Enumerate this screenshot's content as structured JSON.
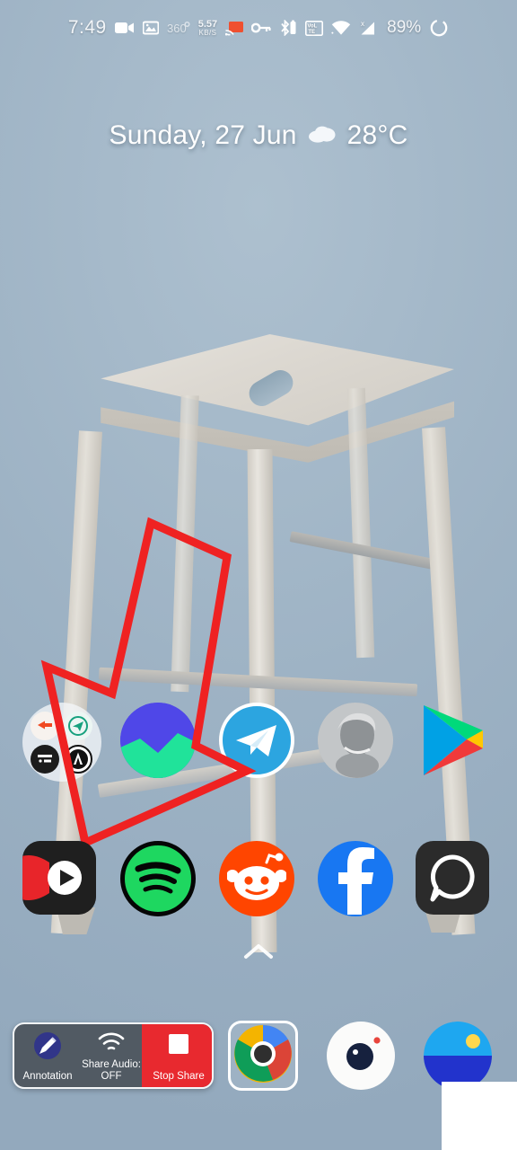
{
  "status_bar": {
    "clock": "7:49",
    "network_speed_value": "5.57",
    "network_speed_unit": "KB/S",
    "battery_percent": "89%",
    "icons": [
      {
        "name": "video-recording-icon",
        "glyph": "▭"
      },
      {
        "name": "screenshot-image-icon",
        "glyph": "▣"
      },
      {
        "name": "360-degree-icon",
        "glyph": "360"
      },
      {
        "name": "cast-icon",
        "glyph": "cast"
      },
      {
        "name": "vpn-key-icon",
        "glyph": "key"
      },
      {
        "name": "bluetooth-icon",
        "glyph": "bt"
      },
      {
        "name": "volte-icon",
        "glyph": "VoLTE"
      },
      {
        "name": "wifi-icon",
        "glyph": "wifi"
      },
      {
        "name": "mobile-signal-icon",
        "glyph": "signal"
      },
      {
        "name": "battery-charging-icon",
        "glyph": "circle"
      }
    ]
  },
  "date_widget": {
    "date_text": "Sunday, 27 Jun",
    "weather_icon": "cloud-icon",
    "temperature": "28°C"
  },
  "home": {
    "page_indicator_glyph": "⌃",
    "row1": [
      {
        "name": "app-folder",
        "label": "Folder",
        "type": "folder",
        "mini_icons": [
          "chat-bubble-orange-icon",
          "telegram-green-icon",
          "card-dark-icon",
          "alpha-circle-icon"
        ]
      },
      {
        "name": "app-weather-circle",
        "label": "Weather",
        "type": "circle",
        "color": "#4f47e8"
      },
      {
        "name": "app-telegram",
        "label": "Telegram",
        "type": "circle",
        "color": "#2ca5e0"
      },
      {
        "name": "app-contact-photo",
        "label": "Contact",
        "type": "circle",
        "color": "#b8bcbf"
      },
      {
        "name": "app-play-store",
        "label": "Play Store",
        "type": "plain",
        "color": "#00a1e5"
      }
    ],
    "row2": [
      {
        "name": "app-youtube-vanced",
        "label": "YouTube Vanced",
        "type": "square",
        "color": "#1f1f1f"
      },
      {
        "name": "app-spotify",
        "label": "Spotify",
        "type": "circle",
        "color": "#1ed760"
      },
      {
        "name": "app-reddit",
        "label": "Reddit",
        "type": "circle",
        "color": "#ff4500"
      },
      {
        "name": "app-facebook",
        "label": "Facebook",
        "type": "circle",
        "color": "#1877f2"
      },
      {
        "name": "app-messages",
        "label": "Messages",
        "type": "square",
        "color": "#2b2b2b"
      }
    ]
  },
  "share_bar": {
    "annotation_label": "Annotation",
    "share_audio_label": "Share Audio:",
    "share_audio_state": "OFF",
    "stop_share_label": "Stop Share",
    "stop_share_color": "#e8292f"
  },
  "dock": [
    {
      "name": "dock-chrome",
      "label": "Chrome",
      "selected": true
    },
    {
      "name": "dock-camera",
      "label": "Camera",
      "selected": false
    },
    {
      "name": "dock-weather",
      "label": "Weather",
      "selected": false
    }
  ],
  "annotation": {
    "shape": "arrow-down-left",
    "color": "#ef2222",
    "stroke_width": 9
  }
}
